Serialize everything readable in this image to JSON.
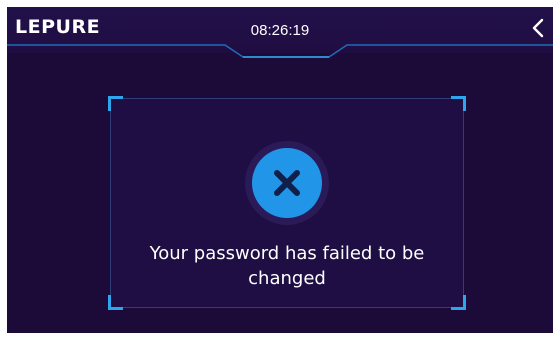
{
  "header": {
    "logo_text": "LEPURE",
    "time": "08:26:19",
    "back_icon": "chevron-left-icon"
  },
  "dialog": {
    "status_icon": "close-icon",
    "message": "Your password has failed to be changed"
  },
  "colors": {
    "background": "#1c0b38",
    "header_background": "#22104a",
    "accent": "#2ea6ee",
    "icon_fill": "#2196e8",
    "text": "#ffffff"
  }
}
